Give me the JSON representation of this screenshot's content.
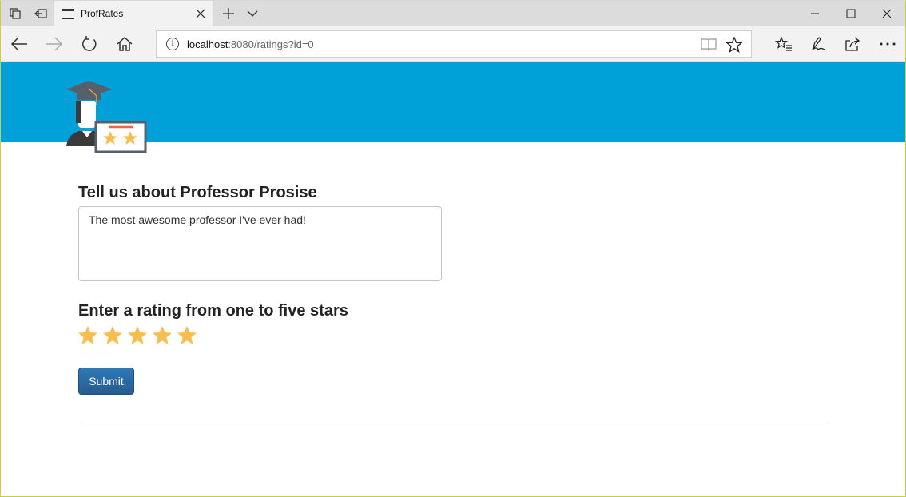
{
  "browser": {
    "tab_title": "ProfRates",
    "url_host": "localhost",
    "url_rest": ":8080/ratings?id=0"
  },
  "page": {
    "review_heading": "Tell us about Professor Prosise",
    "review_text": "The most awesome professor I've ever had!",
    "rating_heading": "Enter a rating from one to five stars",
    "rating": 5,
    "max_rating": 5,
    "submit_label": "Submit"
  },
  "colors": {
    "banner": "#00a0d8",
    "star": "#f7be4f",
    "button": "#286090"
  }
}
